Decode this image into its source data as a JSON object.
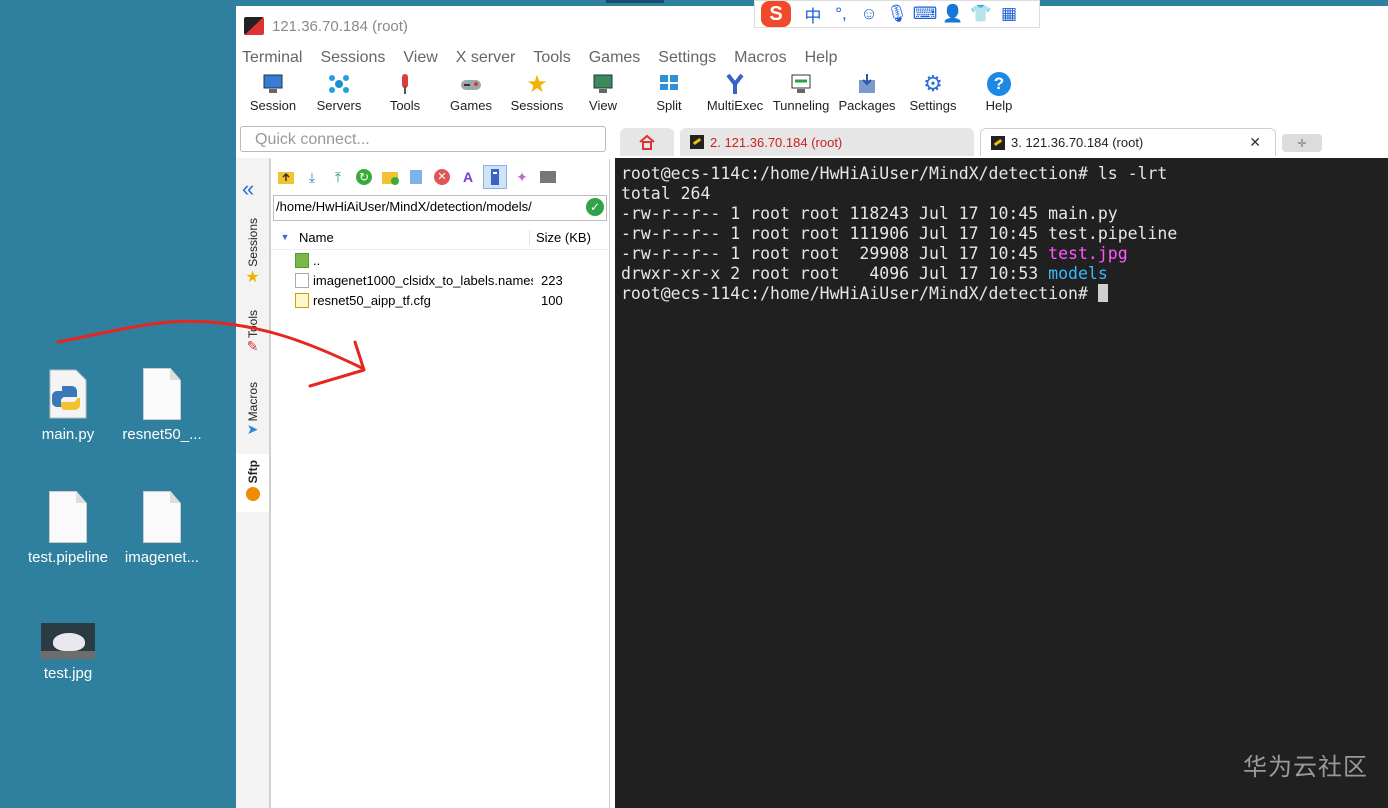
{
  "window_title": "121.36.70.184 (root)",
  "menu": [
    "Terminal",
    "Sessions",
    "View",
    "X server",
    "Tools",
    "Games",
    "Settings",
    "Macros",
    "Help"
  ],
  "toolbar": [
    {
      "label": "Session",
      "icon": "session-icon"
    },
    {
      "label": "Servers",
      "icon": "servers-icon"
    },
    {
      "label": "Tools",
      "icon": "tools-icon"
    },
    {
      "label": "Games",
      "icon": "games-icon"
    },
    {
      "label": "Sessions",
      "icon": "star-icon"
    },
    {
      "label": "View",
      "icon": "view-icon"
    },
    {
      "label": "Split",
      "icon": "split-icon"
    },
    {
      "label": "MultiExec",
      "icon": "multiexec-icon"
    },
    {
      "label": "Tunneling",
      "icon": "tunneling-icon"
    },
    {
      "label": "Packages",
      "icon": "packages-icon"
    },
    {
      "label": "Settings",
      "icon": "settings-icon"
    },
    {
      "label": "Help",
      "icon": "help-icon"
    }
  ],
  "quick_connect": {
    "placeholder": "Quick connect..."
  },
  "tabs": [
    {
      "label": "2. 121.36.70.184 (root)"
    },
    {
      "label": "3. 121.36.70.184 (root)"
    }
  ],
  "side_tabs": [
    "Sessions",
    "Tools",
    "Macros",
    "Sftp"
  ],
  "sftp": {
    "path": "/home/HwHiAiUser/MindX/detection/models/",
    "columns": {
      "name": "Name",
      "size": "Size (KB)"
    },
    "files": [
      {
        "name": "..",
        "size": ""
      },
      {
        "name": "imagenet1000_clsidx_to_labels.names",
        "size": "223"
      },
      {
        "name": "resnet50_aipp_tf.cfg",
        "size": "100"
      }
    ]
  },
  "terminal": {
    "prompt": "root@ecs-114c:/home/HwHiAiUser/MindX/detection# ",
    "command": "ls -lrt",
    "total": "total 264",
    "rows": [
      {
        "meta": "-rw-r--r-- 1 root root 118243 Jul 17 10:45 ",
        "name": "main.py",
        "color": "#e6e6e6"
      },
      {
        "meta": "-rw-r--r-- 1 root root 111906 Jul 17 10:45 ",
        "name": "test.pipeline",
        "color": "#e6e6e6"
      },
      {
        "meta": "-rw-r--r-- 1 root root  29908 Jul 17 10:45 ",
        "name": "test.jpg",
        "color": "#ff58ff"
      },
      {
        "meta": "drwxr-xr-x 2 root root   4096 Jul 17 10:53 ",
        "name": "models",
        "color": "#38b8ff"
      }
    ]
  },
  "desktop_icons": [
    {
      "label": "main.py",
      "icon": "python-file-icon"
    },
    {
      "label": "resnet50_...",
      "icon": "file-icon"
    },
    {
      "label": "test.pipeline",
      "icon": "file-icon"
    },
    {
      "label": "imagenet...",
      "icon": "file-icon"
    },
    {
      "label": "test.jpg",
      "icon": "image-thumbnail"
    }
  ],
  "ime": {
    "logo": "S",
    "mode": "中",
    "punct": "°,"
  },
  "watermark": "华为云社区",
  "colors": {
    "desktop": "#2f7f9e",
    "terminal_bg": "#202020",
    "accent": "#2a6fd6",
    "annotation": "#e8251f"
  }
}
